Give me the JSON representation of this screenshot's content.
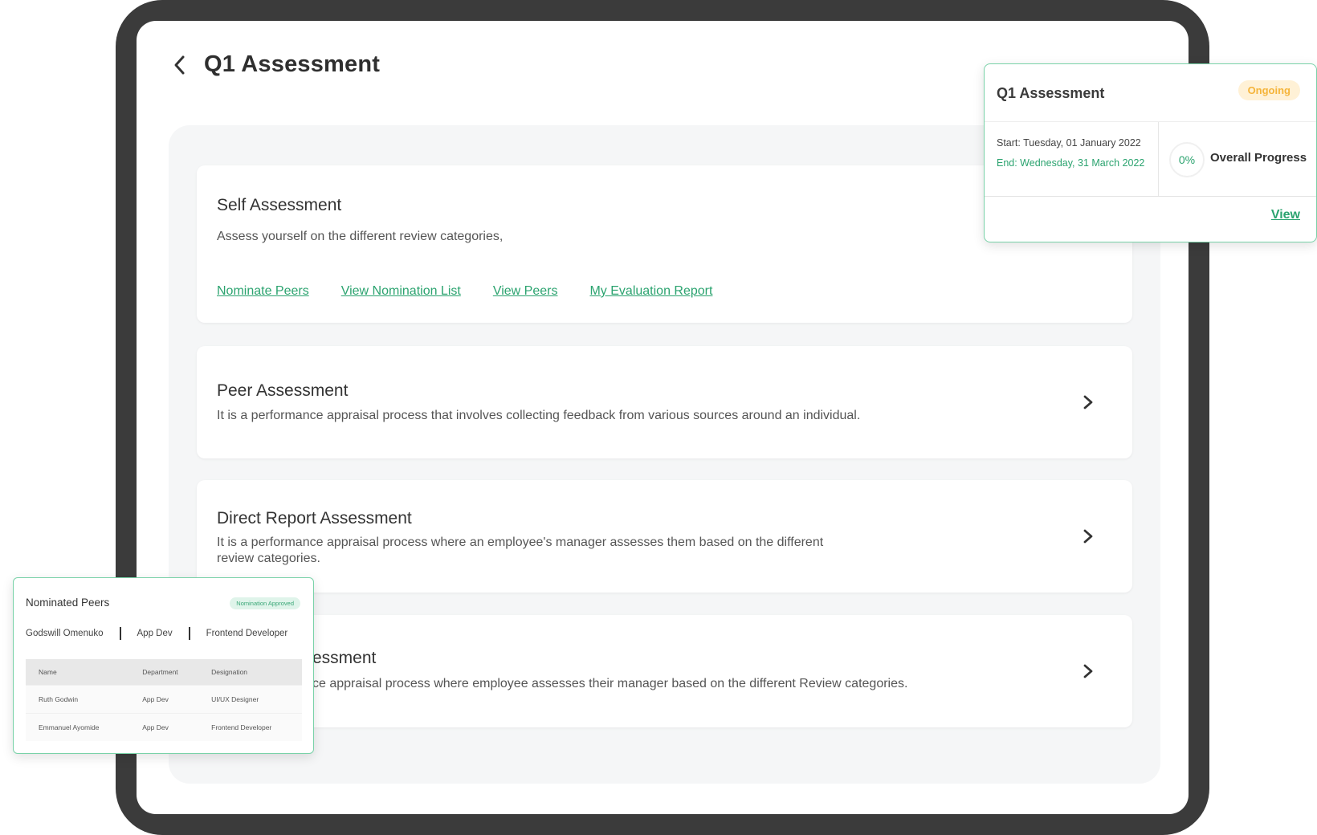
{
  "page": {
    "title": "Q1 Assessment"
  },
  "cards": [
    {
      "title": "Self Assessment",
      "description": "Assess yourself on the different review categories,",
      "links": [
        "Nominate Peers",
        "View Nomination List",
        "View Peers",
        "My Evaluation Report"
      ]
    },
    {
      "title": "Peer Assessment",
      "description": "It is a performance appraisal process that involves collecting feedback from various sources around an individual."
    },
    {
      "title": "Direct Report Assessment",
      "description": "It is a performance appraisal process where an employee's manager assesses them based on the different review categories."
    },
    {
      "title": "essment",
      "description": "ce appraisal process where employee assesses their manager based on the different Review categories."
    }
  ],
  "overview": {
    "title": "Q1 Assessment",
    "status": "Ongoing",
    "start": "Start: Tuesday, 01 January 2022",
    "end": "End: Wednesday, 31 March 2022",
    "progress_value": "0%",
    "progress_label": "Overall Progress",
    "view_label": "View"
  },
  "nominated": {
    "title": "Nominated Peers",
    "status": "Nomination Approved",
    "person": {
      "name": "Godswill Omenuko",
      "department": "App Dev",
      "designation": "Frontend Developer"
    },
    "columns": [
      "Name",
      "Department",
      "Designation"
    ],
    "rows": [
      [
        "Ruth Godwin",
        "App Dev",
        "UI/UX Designer"
      ],
      [
        "Emmanuel Ayomide",
        "App Dev",
        "Frontend Developer"
      ]
    ]
  },
  "colors": {
    "accent": "#2ba36f",
    "badge_ongoing": "#f5b43a",
    "frame": "#3b3b3b"
  }
}
